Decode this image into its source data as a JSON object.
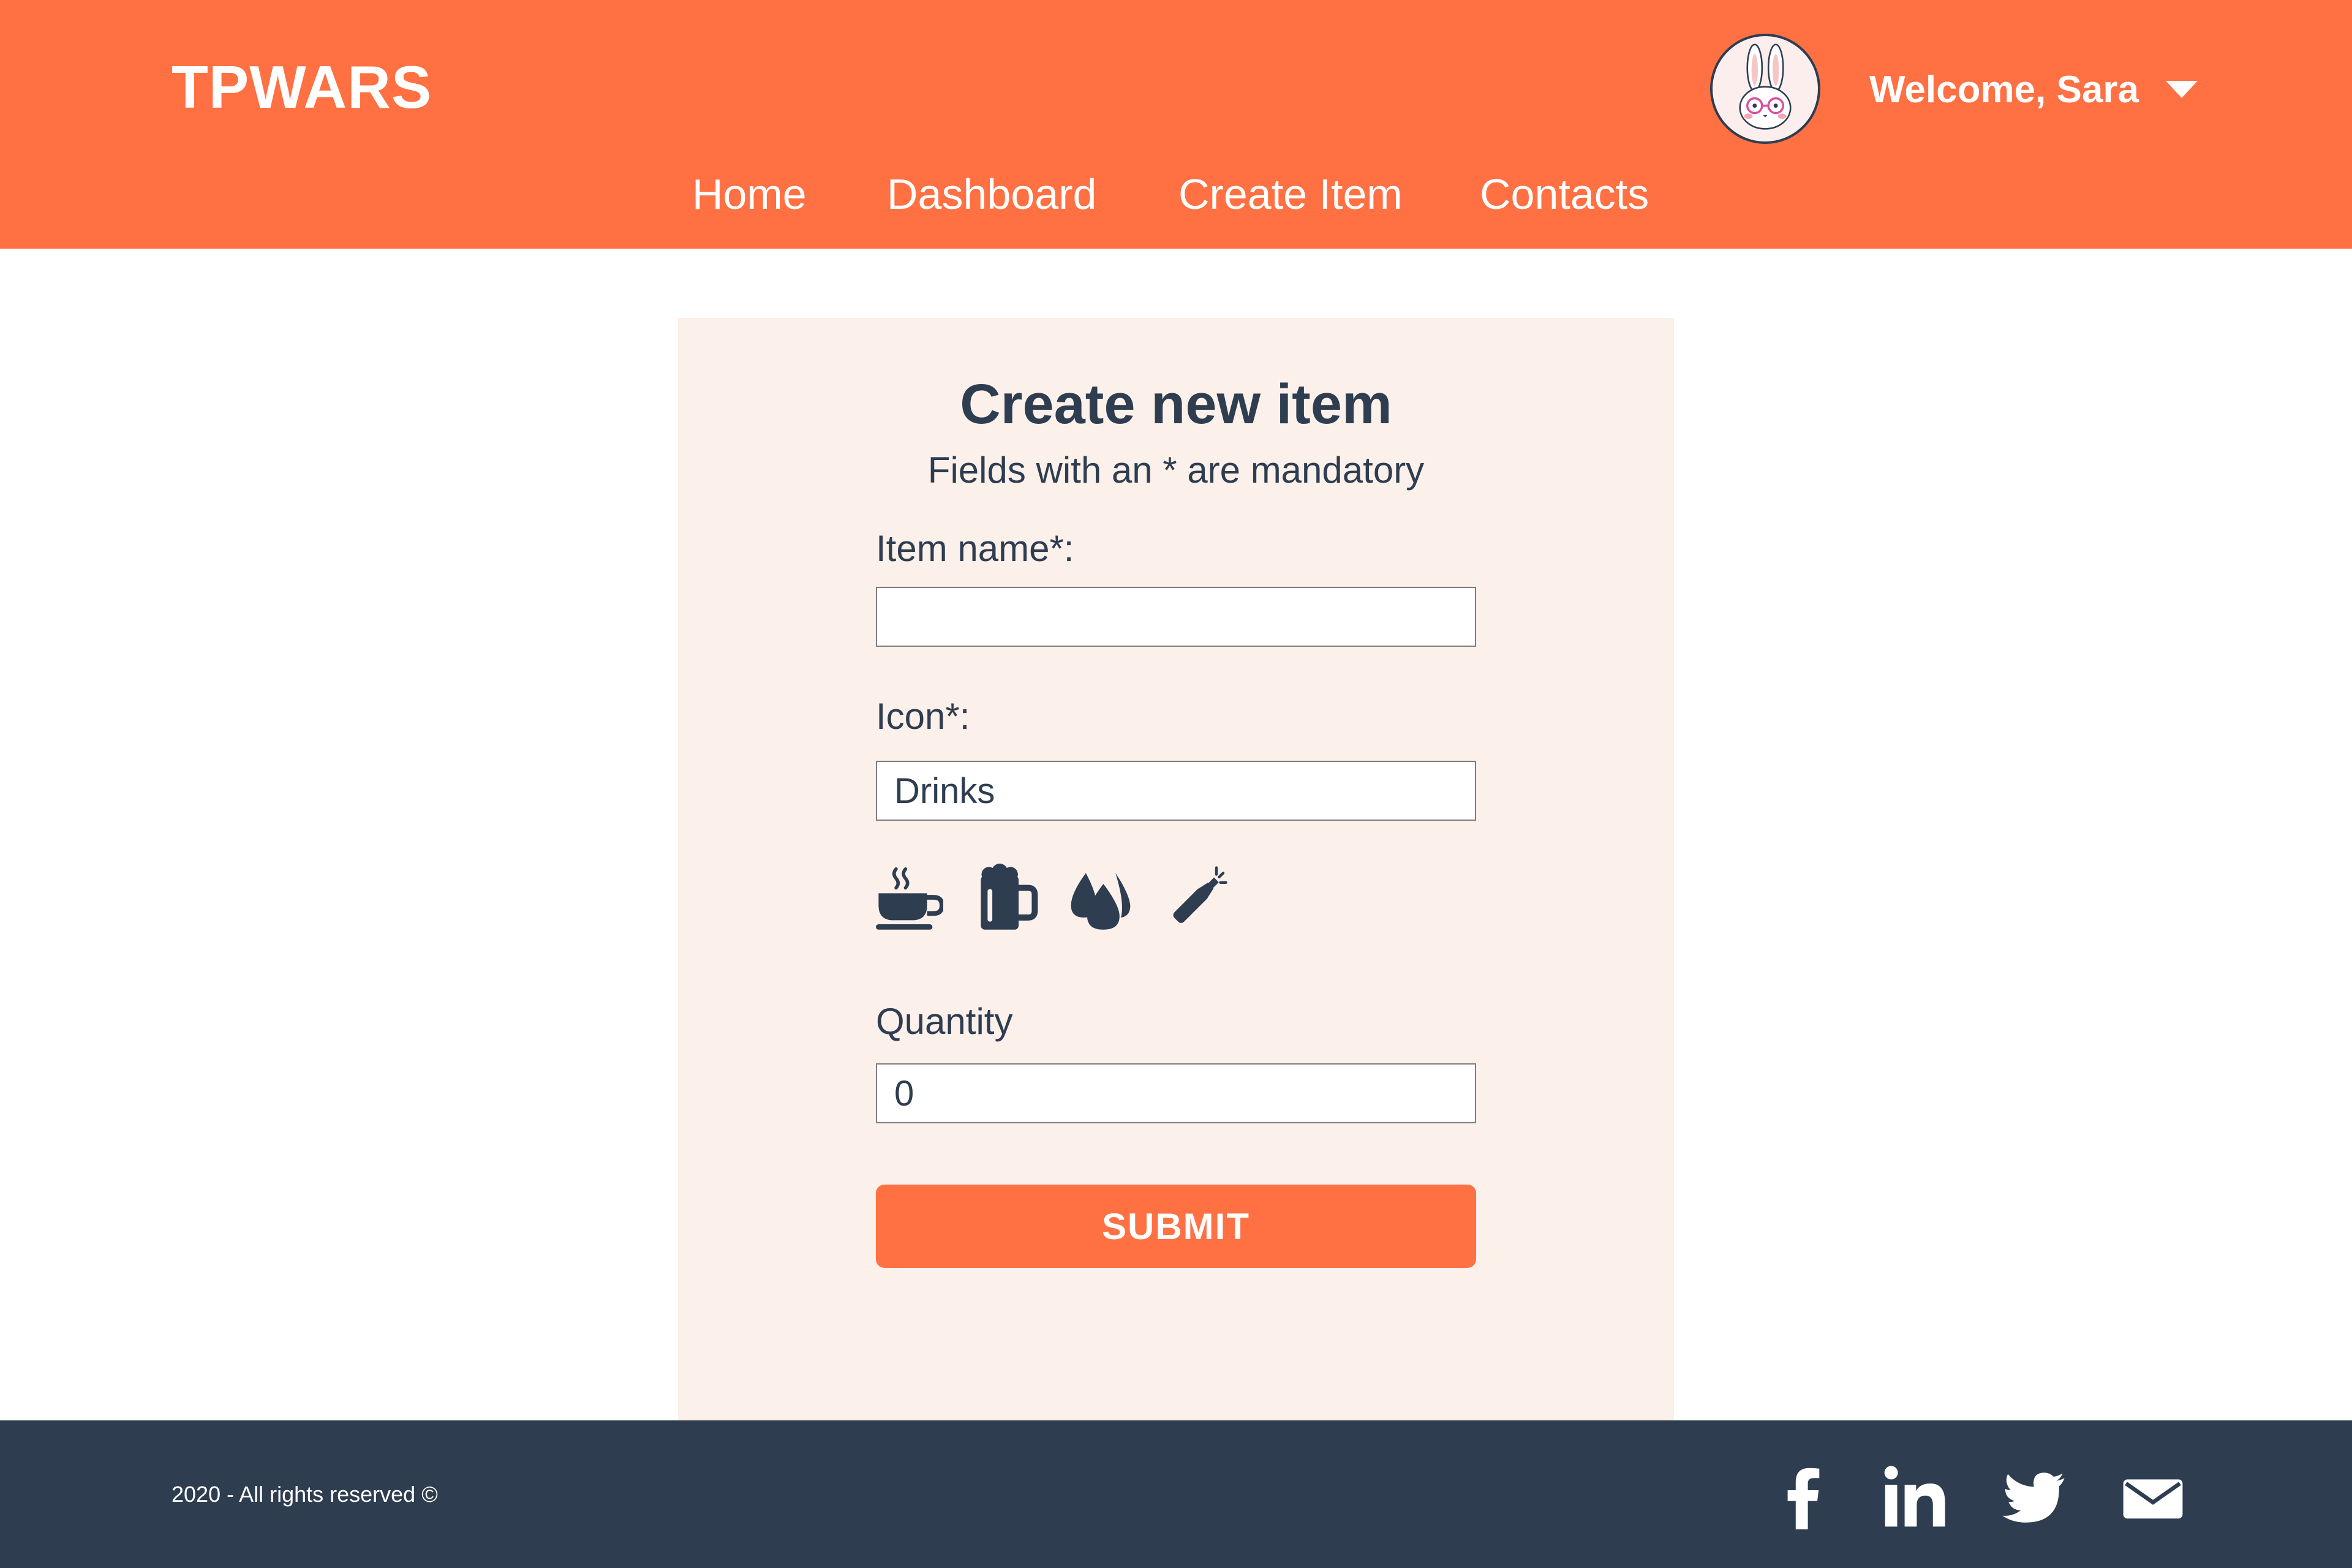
{
  "header": {
    "brand": "TPWARS",
    "welcome": "Welcome, Sara",
    "avatar_icon": "bunny-avatar-icon",
    "nav": [
      {
        "label": "Home"
      },
      {
        "label": "Dashboard"
      },
      {
        "label": "Create Item"
      },
      {
        "label": "Contacts"
      }
    ]
  },
  "form": {
    "title": "Create new item",
    "subtitle": "Fields with an * are mandatory",
    "item_name": {
      "label": "Item name*:",
      "value": ""
    },
    "icon": {
      "label": "Icon*:",
      "value": "Drinks"
    },
    "icon_options": [
      "coffee-cup-icon",
      "beer-mug-icon",
      "water-drops-icon",
      "champagne-bottle-icon"
    ],
    "quantity": {
      "label": "Quantity",
      "value": "0"
    },
    "submit_label": "SUBMIT"
  },
  "footer": {
    "copyright": "2020 - All rights reserved ©",
    "social": [
      "facebook-icon",
      "linkedin-icon",
      "twitter-icon",
      "mail-icon"
    ]
  },
  "colors": {
    "primary": "#ff7043",
    "dark": "#2e3d50",
    "card_bg": "#fcf0eb"
  }
}
